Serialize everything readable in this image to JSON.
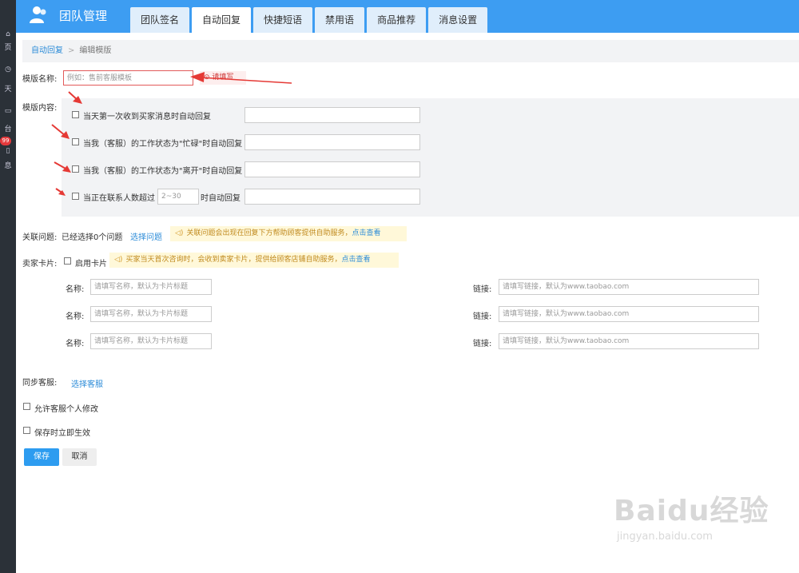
{
  "app": {
    "title": "团队管理"
  },
  "leftbar": {
    "items": [
      "页",
      "天",
      "台",
      "息"
    ],
    "badge": "99"
  },
  "tabs": [
    "团队签名",
    "自动回复",
    "快捷短语",
    "禁用语",
    "商品推荐",
    "消息设置"
  ],
  "breadcrumb": {
    "link": "自动回复",
    "sep": ">",
    "current": "编辑模版"
  },
  "form": {
    "name_label": "模版名称:",
    "name_placeholder": "例如：售前客服模板",
    "name_tip": "请填写",
    "content_label": "模版内容:",
    "options": [
      "当天第一次收到买家消息时自动回复",
      "当我（客服）的工作状态为\"忙碌\"时自动回复",
      "当我（客服）的工作状态为\"离开\"时自动回复",
      "当正在联系人数超过"
    ],
    "count_placeholder": "2~30",
    "count_suffix": "时自动回复",
    "related_label": "关联问题:",
    "related_value": "已经选择0个问题",
    "related_link": "选择问题",
    "related_tip": "关联问题会出现在回复下方帮助顾客提供自助服务，",
    "related_tip_link": "点击查看",
    "card_label": "卖家卡片:",
    "card_enable": "启用卡片",
    "card_tip": "买家当天首次咨询时，会收到卖家卡片，提供给顾客店铺自助服务，",
    "card_tip_link": "点击查看",
    "card_name_label": "名称:",
    "card_name_placeholder": "请填写名称，默认为卡片标题",
    "card_link_label": "链接:",
    "card_link_placeholder": "请填写链接，默认为www.taobao.com",
    "sync_label": "同步客服:",
    "sync_link": "选择客服",
    "allow_edit": "允许客服个人修改",
    "effective": "保存时立即生效",
    "save": "保存",
    "cancel": "取消"
  },
  "watermark": {
    "main": "Baidu经验",
    "sub": "jingyan.baidu.com"
  },
  "colors": {
    "header": "#3d9df2",
    "sidebar": "#2b3138",
    "link": "#2d8cd8",
    "annotation": "#e53935"
  }
}
